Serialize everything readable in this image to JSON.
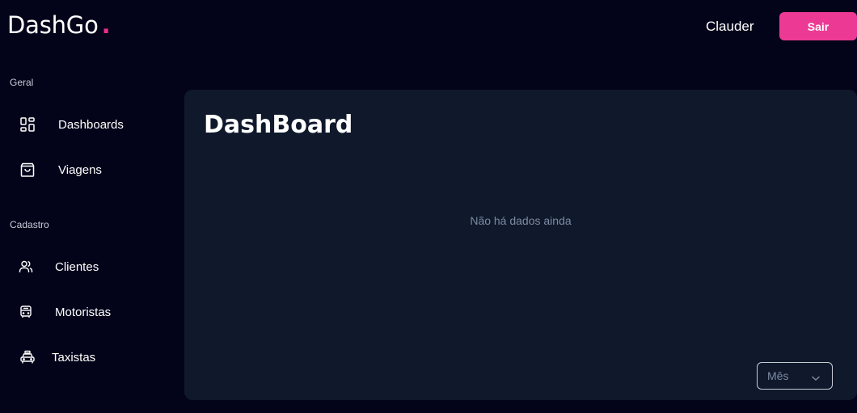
{
  "header": {
    "logo_text": "DashGo",
    "logo_dot": ".",
    "user_name": "Clauder",
    "logout_label": "Sair"
  },
  "sidebar": {
    "sections": [
      {
        "title": "Geral",
        "items": [
          {
            "label": "Dashboards",
            "icon": "dashboard-grid-icon"
          },
          {
            "label": "Viagens",
            "icon": "shopping-bag-icon"
          }
        ]
      },
      {
        "title": "Cadastro",
        "items": [
          {
            "label": "Clientes",
            "icon": "users-icon"
          },
          {
            "label": "Motoristas",
            "icon": "bus-icon"
          },
          {
            "label": "Taxistas",
            "icon": "taxi-icon"
          }
        ]
      }
    ]
  },
  "main": {
    "title": "DashBoard",
    "empty_message": "Não há dados ainda",
    "period_select": {
      "value": "Mês"
    }
  },
  "colors": {
    "background": "#03041a",
    "panel": "#0f192b",
    "accent": "#ec3a94"
  }
}
